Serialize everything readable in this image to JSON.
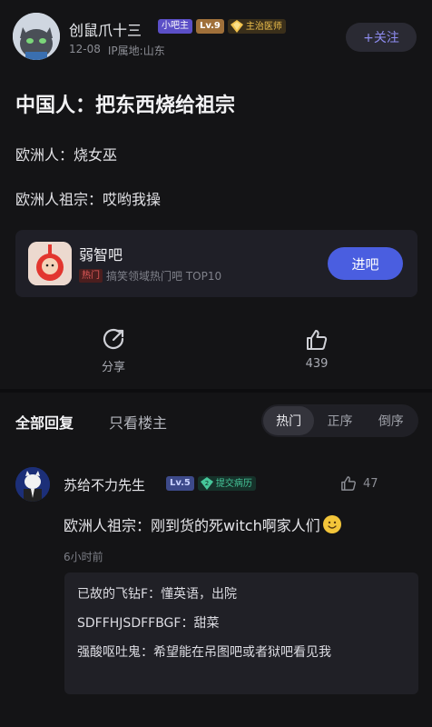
{
  "post": {
    "author": {
      "name": "创鼠爪十三",
      "badges": [
        "小吧主",
        "Lv.9",
        "主治医师"
      ],
      "date": "12-08",
      "ip_location": "IP属地:山东"
    },
    "follow_label": "+关注",
    "title": "中国人：把东西烧给祖宗",
    "lines": [
      "欧洲人：烧女巫",
      "欧洲人祖宗：哎哟我操"
    ],
    "forum": {
      "name": "弱智吧",
      "hot_tag": "热门",
      "description": "搞笑领域热门吧 TOP10",
      "enter_label": "进吧"
    },
    "actions": {
      "share_label": "分享",
      "like_count": "439"
    }
  },
  "replies_header": {
    "tab_all": "全部回复",
    "tab_op_only": "只看楼主",
    "sort_options": [
      "热门",
      "正序",
      "倒序"
    ],
    "sort_selected": "热门"
  },
  "comment": {
    "author": "苏给不力先生",
    "badges": [
      "Lv.5",
      "提交病历"
    ],
    "likes": "47",
    "text": "欧洲人祖宗：刚到货的死witch啊家人们",
    "emoji": "smiley-emoji",
    "time": "6小时前",
    "sub_replies": [
      {
        "author": "已故的飞钻F：",
        "text": "懂英语，出院"
      },
      {
        "author": "SDFFHJSDFFBGF：",
        "text": "甜菜"
      },
      {
        "author": "强酸呕吐鬼：",
        "text": "希望能在吊图吧或者狱吧看见我"
      }
    ]
  },
  "colors": {
    "background": "#141416",
    "accent": "#4a5ee0",
    "follow_text": "#8e8cf0",
    "hot_red": "#e35a5a",
    "doctor_gold": "#f1c24d",
    "case_green": "#46c79a"
  }
}
